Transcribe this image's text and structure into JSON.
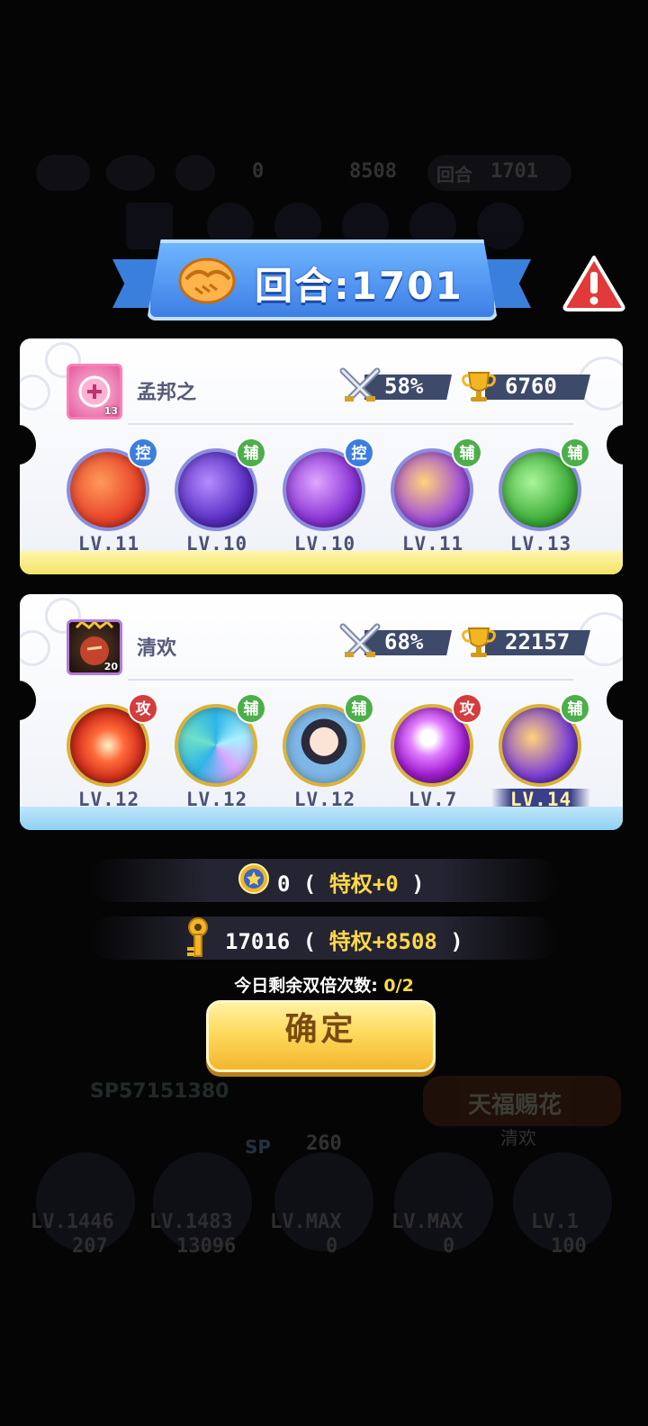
{
  "background": {
    "topbar": {
      "coins": "0",
      "keys": "8508",
      "round_label": "回合",
      "round_value": "1701"
    },
    "sp_id": "SP57151380",
    "sp_label": "SP",
    "sp_value": "260",
    "player_name": "清欢",
    "logo_text": "天福赐花",
    "levels": [
      "LV.1446",
      "LV.1483",
      "LV.MAX",
      "LV.MAX",
      "LV.1"
    ],
    "values": [
      "207",
      "13096",
      "0",
      "0",
      "100"
    ]
  },
  "banner": {
    "title": "回合:1701"
  },
  "players": [
    {
      "name": "孟邦之",
      "avatar_level": "13",
      "win_rate": "58%",
      "trophies": "6760",
      "heroes": [
        {
          "role": "控",
          "role_color": "blue",
          "level": "LV.11",
          "color": "#e8442a",
          "icon": "monkey-hero-icon"
        },
        {
          "role": "辅",
          "role_color": "green",
          "level": "LV.10",
          "color": "#5a2fc4",
          "icon": "lightning-hero-icon"
        },
        {
          "role": "控",
          "role_color": "blue",
          "level": "LV.10",
          "color": "#8a34d6",
          "icon": "butterfly-hero-icon"
        },
        {
          "role": "辅",
          "role_color": "green",
          "level": "LV.11",
          "color": "#a24fd8",
          "icon": "multi-figure-hero-icon"
        },
        {
          "role": "辅",
          "role_color": "green",
          "level": "LV.13",
          "color": "#3fae3a",
          "icon": "arrow-up-hero-icon"
        }
      ]
    },
    {
      "name": "清欢",
      "avatar_level": "20",
      "win_rate": "68%",
      "trophies": "22157",
      "heroes": [
        {
          "role": "攻",
          "role_color": "red",
          "level": "LV.12",
          "color": "#d6331e",
          "icon": "flare-hero-icon"
        },
        {
          "role": "辅",
          "role_color": "green",
          "level": "LV.12",
          "color": "#2fb6e6",
          "icon": "swirl-hero-icon"
        },
        {
          "role": "辅",
          "role_color": "green",
          "level": "LV.12",
          "color": "#7fb8e8",
          "icon": "girl-hero-icon"
        },
        {
          "role": "攻",
          "role_color": "red",
          "level": "LV.7",
          "color": "#a21fd0",
          "icon": "glove-hero-icon"
        },
        {
          "role": "辅",
          "role_color": "green",
          "level": "LV.14",
          "color": "#7c3fd6",
          "icon": "multi-figure-hero-icon",
          "highlight": true
        }
      ]
    }
  ],
  "rewards": {
    "coin_value": "0",
    "coin_open": " ( ",
    "coin_priv": "特权+0",
    "coin_close": " )",
    "key_value": "17016",
    "key_open": " ( ",
    "key_priv": "特权+8508",
    "key_close": " )"
  },
  "double": {
    "label": "今日剩余双倍次数:",
    "value": "0/2"
  },
  "confirm": {
    "label": "确定"
  },
  "colors": {
    "accent_yellow": "#ffd84a",
    "banner_blue": "#3d7ee6",
    "panel_text": "#4b5373"
  }
}
